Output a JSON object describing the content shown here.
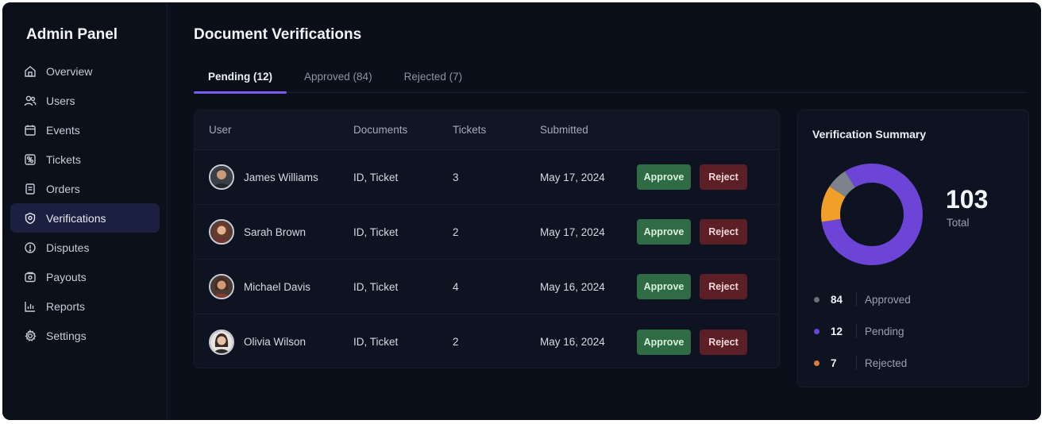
{
  "sidebar": {
    "brand": "Admin Panel",
    "items": [
      {
        "label": "Overview",
        "icon": "overview-icon"
      },
      {
        "label": "Users",
        "icon": "users-icon"
      },
      {
        "label": "Events",
        "icon": "calendar-icon"
      },
      {
        "label": "Tickets",
        "icon": "ticket-icon"
      },
      {
        "label": "Orders",
        "icon": "orders-icon"
      },
      {
        "label": "Verifications",
        "icon": "shield-check-icon",
        "active": true
      },
      {
        "label": "Disputes",
        "icon": "dispute-icon"
      },
      {
        "label": "Payouts",
        "icon": "payout-icon"
      },
      {
        "label": "Reports",
        "icon": "reports-icon"
      },
      {
        "label": "Settings",
        "icon": "gear-icon"
      }
    ]
  },
  "page": {
    "title": "Document Verifications",
    "tabs": [
      {
        "label": "Pending (12)",
        "active": true
      },
      {
        "label": "Approved (84)"
      },
      {
        "label": "Rejected (7)"
      }
    ]
  },
  "table": {
    "headers": {
      "user": "User",
      "documents": "Documents",
      "tickets": "Tickets",
      "submitted": "Submitted"
    },
    "rows": [
      {
        "name": "James Williams",
        "documents": "ID, Ticket",
        "tickets": "3",
        "submitted": "May 17, 2024",
        "approve": "Approve",
        "reject": "Reject"
      },
      {
        "name": "Sarah Brown",
        "documents": "ID, Ticket",
        "tickets": "2",
        "submitted": "May 17, 2024",
        "approve": "Approve",
        "reject": "Reject"
      },
      {
        "name": "Michael Davis",
        "documents": "ID, Ticket",
        "tickets": "4",
        "submitted": "May 16, 2024",
        "approve": "Approve",
        "reject": "Reject"
      },
      {
        "name": "Olivia Wilson",
        "documents": "ID, Ticket",
        "tickets": "2",
        "submitted": "May 16, 2024",
        "approve": "Approve",
        "reject": "Reject"
      }
    ]
  },
  "summary": {
    "title": "Verification Summary",
    "total": "103",
    "total_label": "Total",
    "legend": [
      {
        "value": "84",
        "label": "Approved",
        "color": "#6a7078"
      },
      {
        "value": "12",
        "label": "Pending",
        "color": "#6c45d6"
      },
      {
        "value": "7",
        "label": "Rejected",
        "color": "#e07a3a"
      }
    ],
    "donut_colors": {
      "approved": "#6c45d6",
      "pending": "#f0a028",
      "rejected": "#7d838c"
    }
  }
}
